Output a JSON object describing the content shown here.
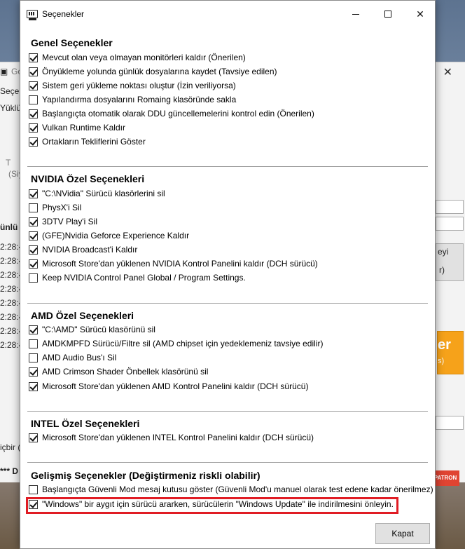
{
  "background_window": {
    "title_fragment": "Go",
    "fragments": [
      "Seçen",
      "Yüklü",
      "T",
      "(Siy",
      "ünlü",
      "2:28:4",
      "2:28:4",
      "2:28:4",
      "2:28:4",
      "2:28:4",
      "2:28:4",
      "2:28:4",
      "2:28:4",
      "içbir (",
      "*** D",
      "eyi",
      "r)",
      "er",
      "s)"
    ],
    "patreon_label": "PATRON"
  },
  "dialog": {
    "title": "Seçenekler",
    "sections": [
      {
        "title": "Genel Seçenekler",
        "options": [
          {
            "label": "Mevcut olan veya olmayan monitörleri kaldır (Önerilen)",
            "checked": true
          },
          {
            "label": "Önyükleme yolunda günlük dosyalarına kaydet (Tavsiye edilen)",
            "checked": true
          },
          {
            "label": "Sistem geri yükleme noktası oluştur (İzin veriliyorsa)",
            "checked": true
          },
          {
            "label": "Yapılandırma dosyalarını Romaing klasöründe sakla",
            "checked": false
          },
          {
            "label": "Başlangıçta otomatik olarak DDU güncellemelerini kontrol edin (Önerilen)",
            "checked": true
          },
          {
            "label": "Vulkan Runtime Kaldır",
            "checked": true
          },
          {
            "label": "Ortakların Tekliflerini Göster",
            "checked": true
          }
        ]
      },
      {
        "title": "NVIDIA Özel Seçenekleri",
        "options": [
          {
            "label": "\"C:\\NVidia\" Sürücü klasörlerini sil",
            "checked": true
          },
          {
            "label": "PhysX'i Sil",
            "checked": false
          },
          {
            "label": "3DTV Play'i Sil",
            "checked": true
          },
          {
            "label": "(GFE)Nvidia Geforce Experience Kaldır",
            "checked": true
          },
          {
            "label": "NVIDIA Broadcast'i Kaldır",
            "checked": true
          },
          {
            "label": "Microsoft Store'dan yüklenen NVIDIA Kontrol Panelini kaldır (DCH sürücü)",
            "checked": true
          },
          {
            "label": "Keep NVIDIA Control Panel Global / Program Settings.",
            "checked": false
          }
        ]
      },
      {
        "title": "AMD Özel Seçenekleri",
        "options": [
          {
            "label": "\"C:\\AMD\" Sürücü klasörünü sil",
            "checked": true
          },
          {
            "label": "AMDKMPFD Sürücü/Filtre sil (AMD chipset için yedeklemeniz tavsiye edilir)",
            "checked": false
          },
          {
            "label": "AMD Audio Bus'ı Sil",
            "checked": false
          },
          {
            "label": "AMD Crimson Shader Önbellek klasörünü sil",
            "checked": true
          },
          {
            "label": "Microsoft Store'dan yüklenen AMD Kontrol Panelini kaldır (DCH sürücü)",
            "checked": true
          }
        ]
      },
      {
        "title": "INTEL Özel Seçenekleri",
        "options": [
          {
            "label": "Microsoft Store'dan yüklenen INTEL Kontrol Panelini kaldır (DCH sürücü)",
            "checked": true
          }
        ]
      },
      {
        "title": "Gelişmiş Seçenekler (Değiştirmeniz riskli olabilir)",
        "options": [
          {
            "label": "Başlangıçta Güvenli Mod mesaj kutusu göster (Güvenli Mod'u manuel olarak test edene kadar önerilmez)",
            "checked": false
          },
          {
            "label": "\"Windows\" bir aygıt için sürücü ararken, sürücülerin \"Windows Update\" ile indirilmesini önleyin.",
            "checked": true
          }
        ]
      }
    ],
    "close_label": "Kapat",
    "highlight_color": "#e01c24"
  }
}
